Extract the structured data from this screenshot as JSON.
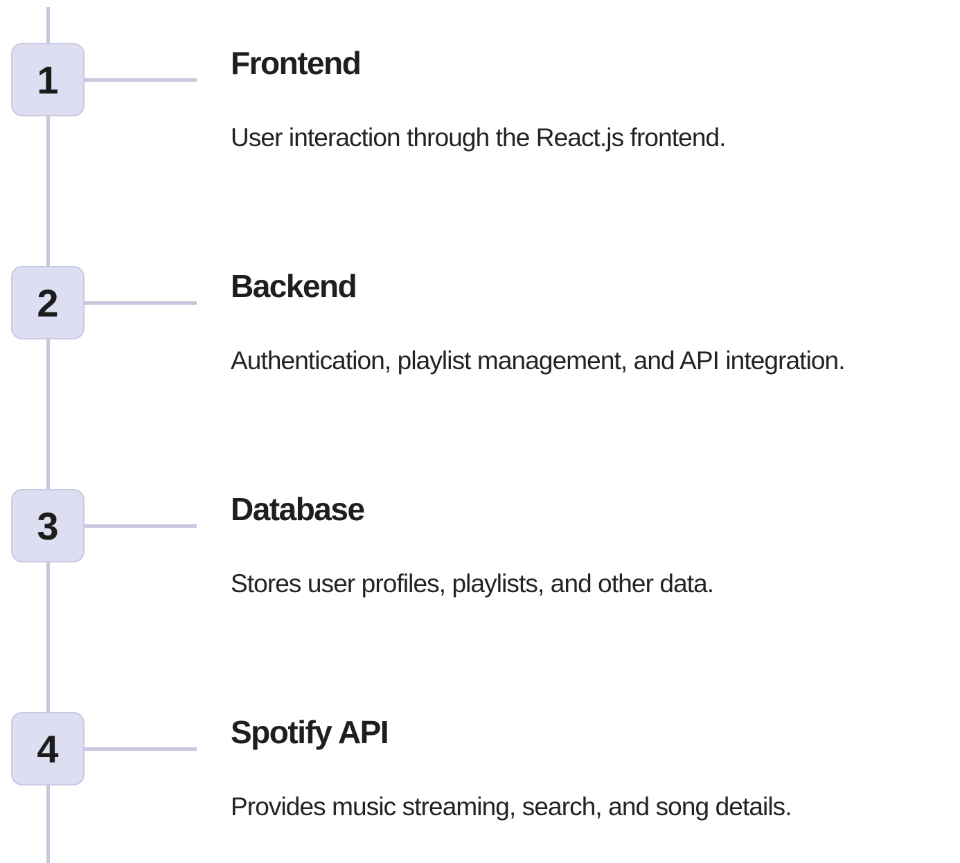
{
  "steps": [
    {
      "number": "1",
      "title": "Frontend",
      "description": "User interaction through the React.js frontend."
    },
    {
      "number": "2",
      "title": "Backend",
      "description": "Authentication, playlist management, and API integration."
    },
    {
      "number": "3",
      "title": "Database",
      "description": "Stores user profiles, playlists, and other data."
    },
    {
      "number": "4",
      "title": "Spotify API",
      "description": "Provides music streaming, search, and song details."
    }
  ],
  "colors": {
    "line": "#c7c7dd",
    "box_fill": "#dedef2",
    "box_border": "#c9c9e3",
    "text": "#1e1e1e"
  }
}
